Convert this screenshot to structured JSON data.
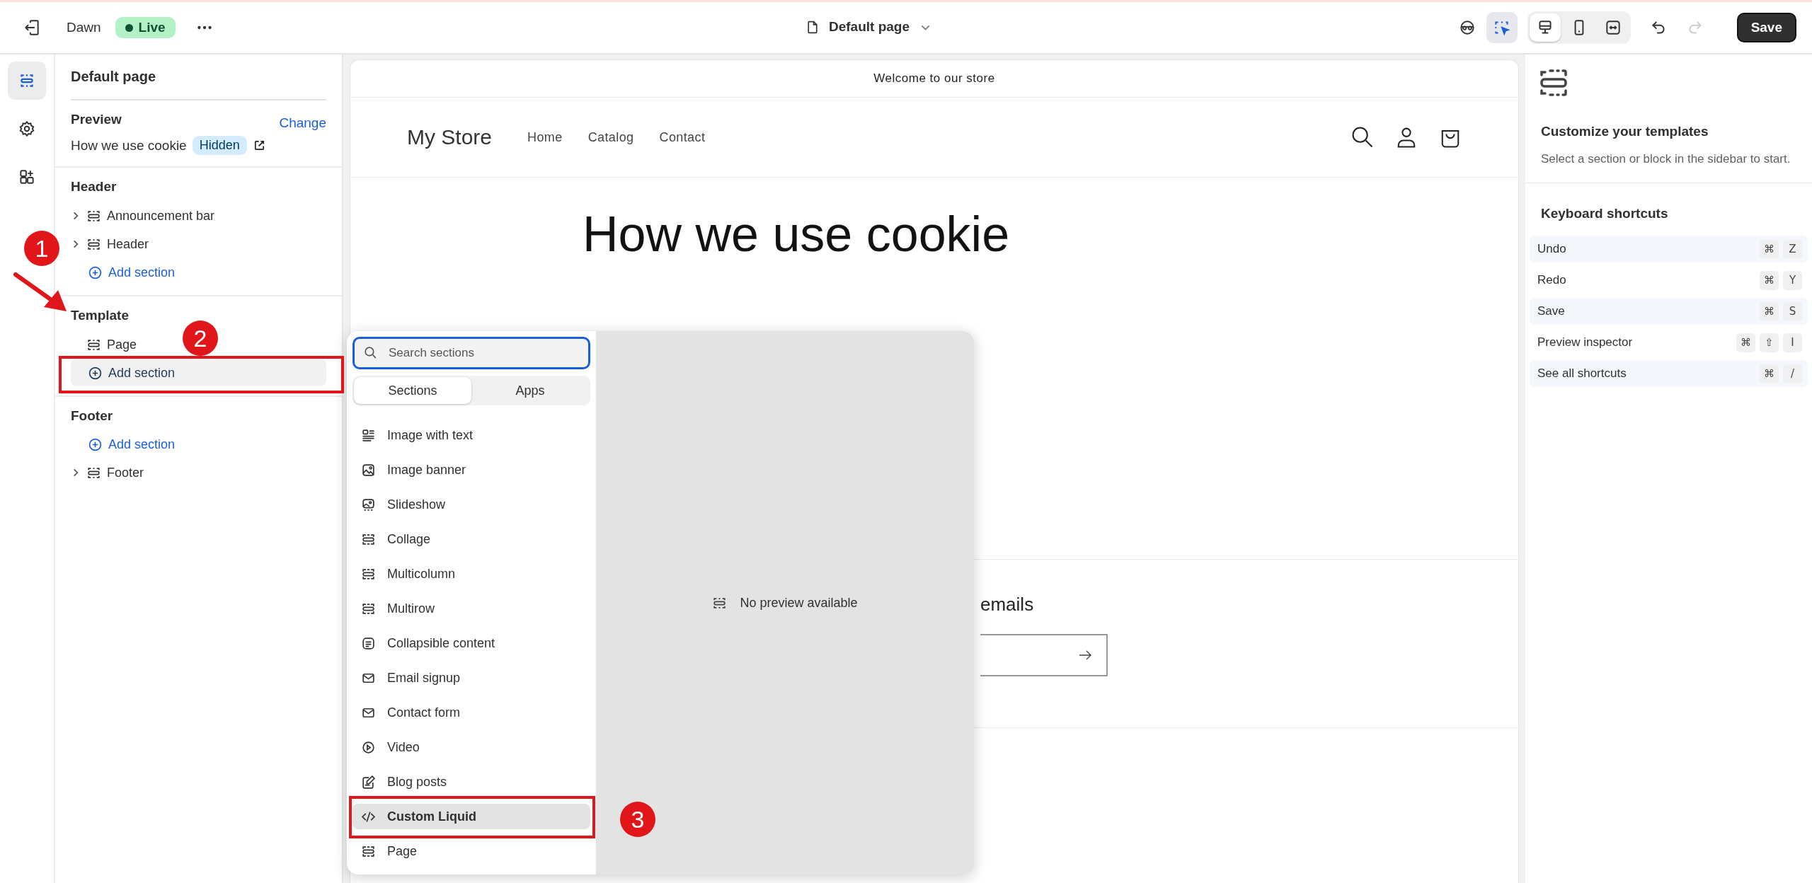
{
  "topbar": {
    "theme": "Dawn",
    "status": "Live",
    "page_selector": "Default page",
    "inspector_on": true,
    "view_modes": [
      {
        "kind": "desktop",
        "selected": true
      },
      {
        "kind": "mobile",
        "selected": false
      },
      {
        "kind": "fullwidth",
        "selected": false
      }
    ],
    "redo_disabled": true,
    "save": "Save"
  },
  "rail": [
    {
      "kind": "sections",
      "selected": true
    },
    {
      "kind": "settings",
      "selected": false
    },
    {
      "kind": "apps",
      "selected": false
    }
  ],
  "sidebar": {
    "title": "Default page",
    "preview": {
      "label": "Preview",
      "action": "Change",
      "page": "How we use cookie",
      "badge": "Hidden"
    },
    "groups": [
      {
        "title": "Header",
        "items": [
          {
            "kind": "section",
            "label": "Announcement bar",
            "expandable": true
          },
          {
            "kind": "section",
            "label": "Header",
            "expandable": true
          },
          {
            "kind": "add",
            "label": "Add section",
            "selected": false
          }
        ]
      },
      {
        "title": "Template",
        "items": [
          {
            "kind": "section",
            "label": "Page",
            "expandable": false
          },
          {
            "kind": "add",
            "label": "Add section",
            "selected": true
          }
        ]
      },
      {
        "title": "Footer",
        "items": [
          {
            "kind": "add",
            "label": "Add section",
            "selected": false
          },
          {
            "kind": "section",
            "label": "Footer",
            "expandable": true
          }
        ]
      }
    ]
  },
  "store": {
    "announcement": "Welcome to our store",
    "logo": "My Store",
    "nav": [
      "Home",
      "Catalog",
      "Contact"
    ],
    "title": "How we use cookie",
    "newsletter_heading": "emails"
  },
  "picker": {
    "search_placeholder": "Search sections",
    "tabs": [
      {
        "label": "Sections",
        "selected": true
      },
      {
        "label": "Apps",
        "selected": false
      }
    ],
    "items": [
      {
        "kind": "image-text",
        "label": "Image with text",
        "selected": false
      },
      {
        "kind": "image",
        "label": "Image banner",
        "selected": false
      },
      {
        "kind": "slides",
        "label": "Slideshow",
        "selected": false
      },
      {
        "kind": "section",
        "label": "Collage",
        "selected": false
      },
      {
        "kind": "section",
        "label": "Multicolumn",
        "selected": false
      },
      {
        "kind": "section",
        "label": "Multirow",
        "selected": false
      },
      {
        "kind": "doc",
        "label": "Collapsible content",
        "selected": false
      },
      {
        "kind": "mail",
        "label": "Email signup",
        "selected": false
      },
      {
        "kind": "mail",
        "label": "Contact form",
        "selected": false
      },
      {
        "kind": "play",
        "label": "Video",
        "selected": false
      },
      {
        "kind": "edit",
        "label": "Blog posts",
        "selected": false
      },
      {
        "kind": "code",
        "label": "Custom Liquid",
        "selected": true
      },
      {
        "kind": "section",
        "label": "Page",
        "selected": false
      }
    ],
    "preview_message": "No preview available"
  },
  "inspector": {
    "title": "Customize your templates",
    "description": "Select a section or block in the sidebar to start.",
    "shortcuts_title": "Keyboard shortcuts",
    "shortcuts": [
      {
        "label": "Undo",
        "keys": [
          "⌘",
          "Z"
        ]
      },
      {
        "label": "Redo",
        "keys": [
          "⌘",
          "Y"
        ]
      },
      {
        "label": "Save",
        "keys": [
          "⌘",
          "S"
        ]
      },
      {
        "label": "Preview inspector",
        "keys": [
          "⌘",
          "⇧",
          "I"
        ]
      },
      {
        "label": "See all shortcuts",
        "keys": [
          "⌘",
          "/"
        ]
      }
    ]
  },
  "annotations": [
    {
      "label": "1"
    },
    {
      "label": "2"
    },
    {
      "label": "3"
    }
  ]
}
